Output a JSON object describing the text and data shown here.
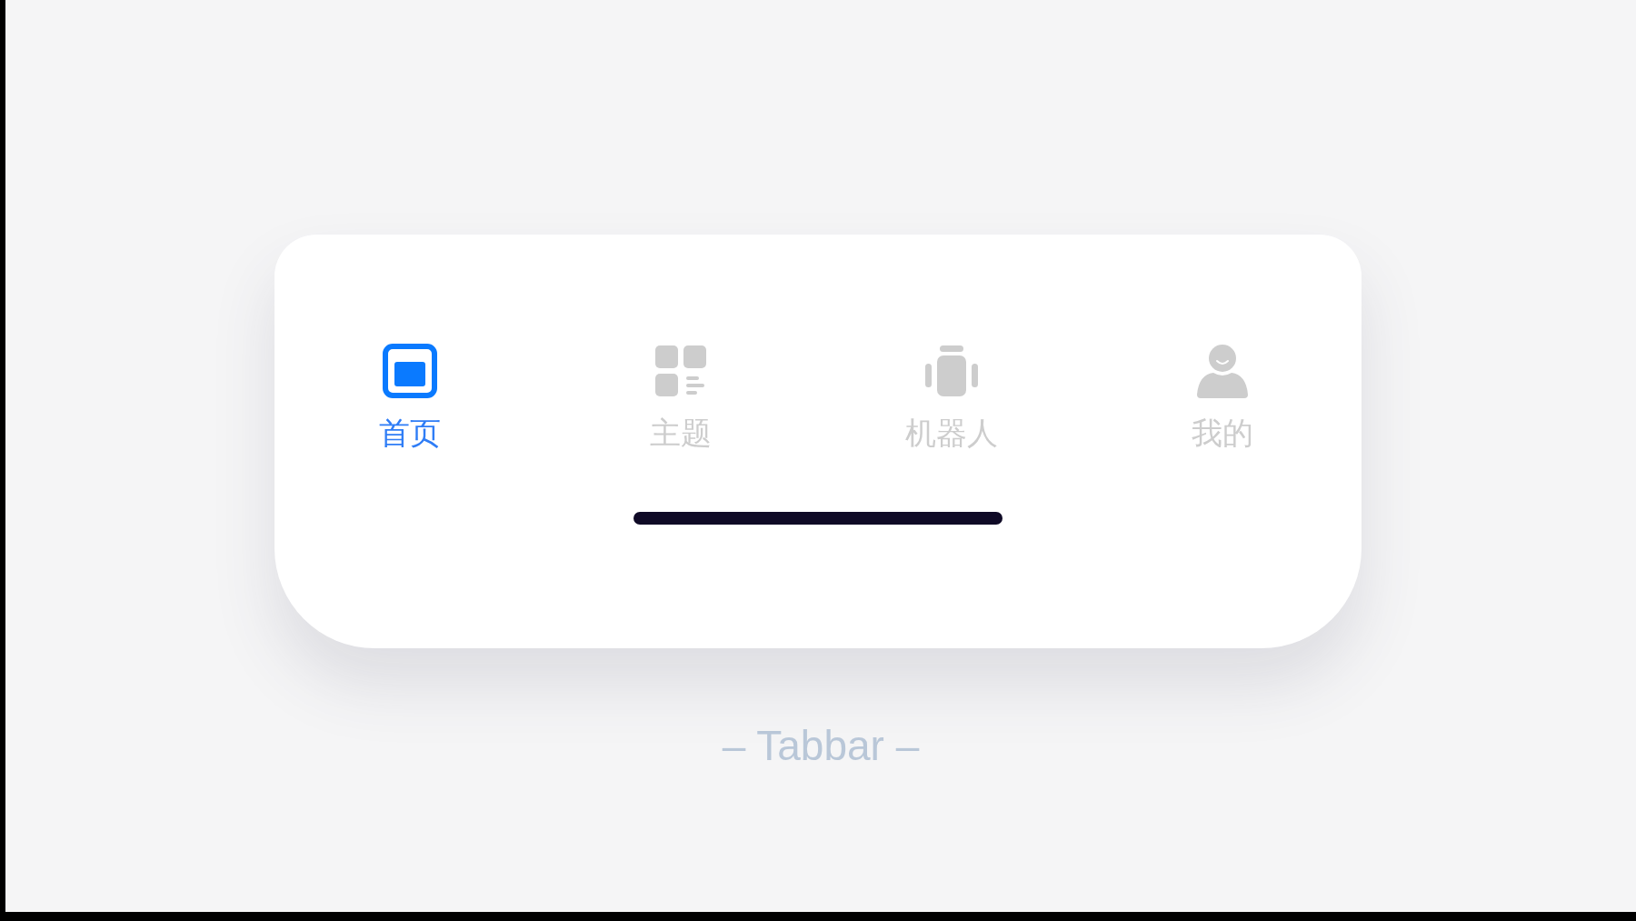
{
  "tabbar": {
    "tabs": [
      {
        "kind": "home",
        "label": "首页",
        "selected": true
      },
      {
        "kind": "topics",
        "label": "主题",
        "selected": false
      },
      {
        "kind": "robot",
        "label": "机器人",
        "selected": false
      },
      {
        "kind": "profile",
        "label": "我的",
        "selected": false
      }
    ]
  },
  "caption": "– Tabbar –"
}
